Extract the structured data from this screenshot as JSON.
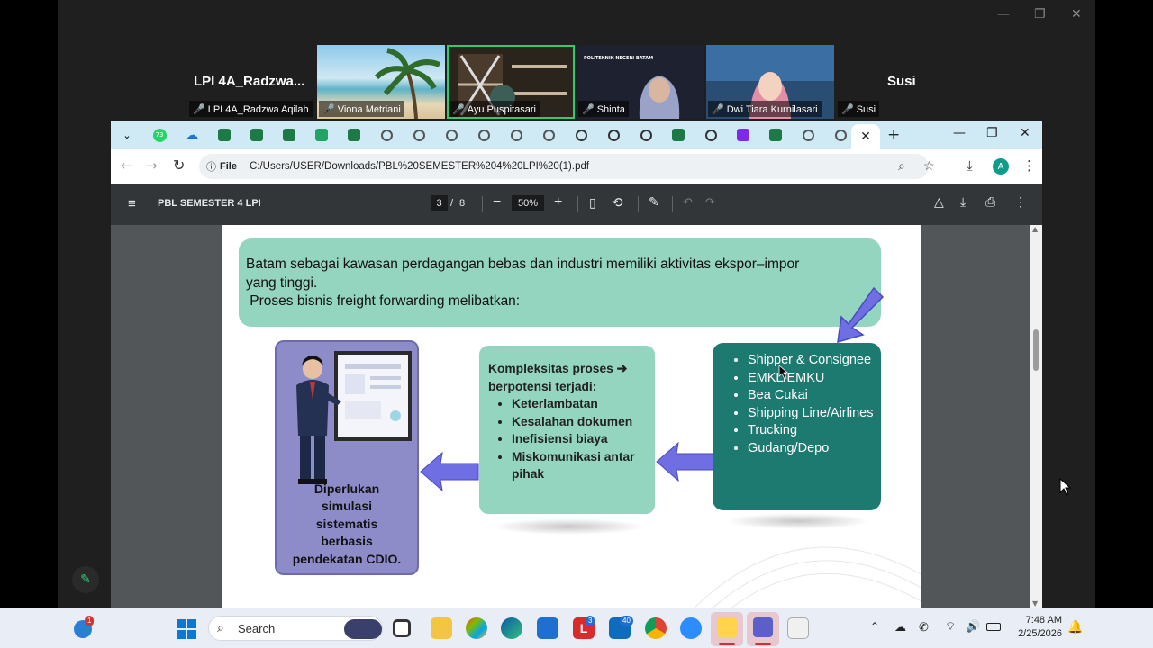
{
  "meeting": {
    "left_name_card": "LPI  4A_Radzwa...",
    "right_name_card": "Susi",
    "participants": [
      {
        "label": "LPI 4A_Radzwa Aqilah"
      },
      {
        "label": "Viona Metriani"
      },
      {
        "label": "Ayu Puspitasari"
      },
      {
        "label": "Shinta"
      },
      {
        "label": "Dwi Tiara Kurnilasari"
      },
      {
        "label": "Susi"
      }
    ],
    "tile_overlay_text": "POLITEKNIK NEGERI BATAM"
  },
  "browser": {
    "tab_badge": "73",
    "close_tab": "✕",
    "new_tab": "+",
    "url_chip": "File",
    "url": "C:/Users/USER/Downloads/PBL%20SEMESTER%204%20LPI%20(1).pdf",
    "profile_initial": "A"
  },
  "pdf": {
    "title": "PBL SEMESTER 4 LPI",
    "page_current": "3",
    "page_sep": "/",
    "page_total": "8",
    "zoom": "50%"
  },
  "slide": {
    "banner_line1": "Batam sebagai kawasan perdagangan bebas dan industri memiliki aktivitas ekspor–impor",
    "banner_line2": "yang tinggi.",
    "banner_line3": " Proses bisnis freight forwarding melibatkan:",
    "left_text": [
      "Diperlukan",
      "simulasi",
      "sistematis",
      "berbasis",
      "pendekatan CDIO."
    ],
    "mid_heading_1": "Kompleksitas proses ➔",
    "mid_heading_2": "berpotensi terjadi:",
    "mid_items": [
      "Keterlambatan",
      "Kesalahan dokumen",
      "Inefisiensi biaya",
      "Miskomunikasi antar pihak"
    ],
    "right_items": [
      "Shipper & Consignee",
      "EMKL/EMKU",
      "Bea Cukai",
      "Shipping Line/Airlines",
      "Trucking",
      "Gudang/Depo"
    ]
  },
  "taskbar": {
    "search_placeholder": "Search",
    "badge_start": "1",
    "badge_l": "3",
    "badge_mail": "40",
    "time": "7:48 AM",
    "date": "2/25/2026"
  },
  "colors": {
    "tabbar": "#cfe9f5",
    "banner": "#93d5bf",
    "left_box": "#8d8cc9",
    "right_box": "#1c7a70",
    "arrow": "#6f6fe3"
  }
}
